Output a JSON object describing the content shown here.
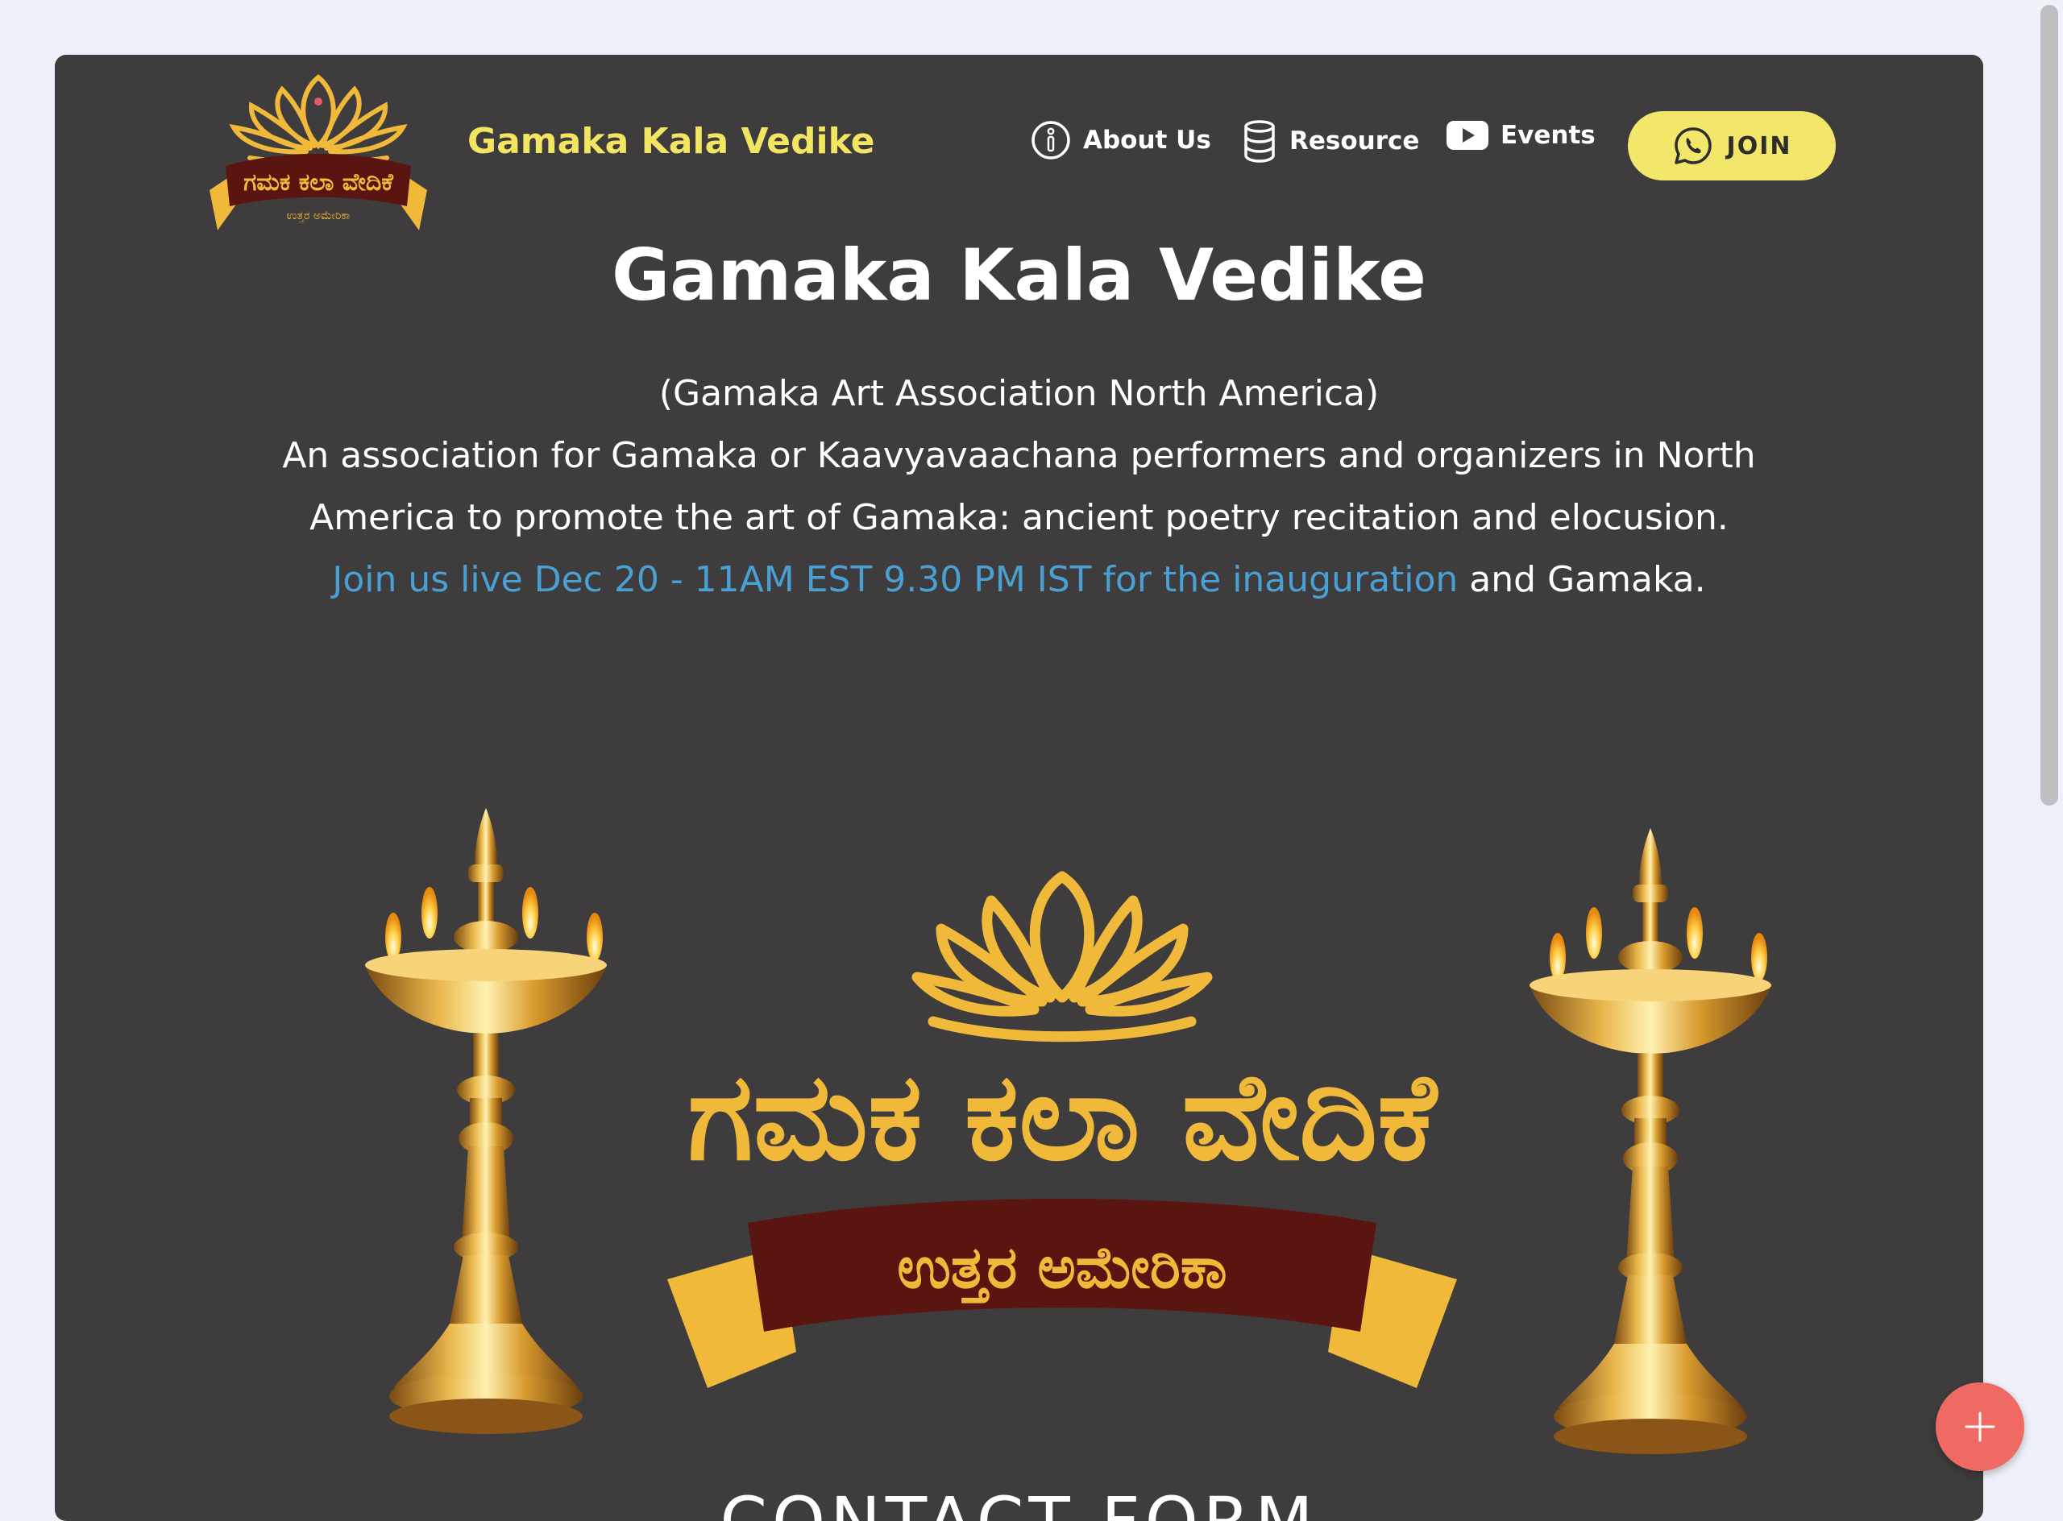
{
  "header": {
    "logo_alt": "ಗಮಕ ಕಲಾ ವೇದಿಕೆ ಉತ್ತರ ಅಮೇರಿಕಾ",
    "brand": "Gamaka Kala Vedike",
    "nav": [
      {
        "label": "About Us",
        "icon": "info-icon"
      },
      {
        "label": "Resource",
        "icon": "database-icon"
      },
      {
        "label": "Events",
        "icon": "youtube-icon"
      }
    ],
    "join": {
      "label": "JOIN",
      "icon": "whatsapp-icon"
    }
  },
  "hero": {
    "title": "Gamaka Kala Vedike",
    "subtitle": "(Gamaka Art Association North America)",
    "line1": "An association for Gamaka or Kaavyavaachana performers and organizers in North",
    "line2": "America to promote the art of Gamaka: ancient poetry recitation and elocusion.",
    "link_text": "Join us live Dec 20 - 11AM EST 9.30 PM IST for the inauguration",
    "link_suffix": " and Gamaka."
  },
  "banner": {
    "title_kn": "ಗಮಕ ಕಲಾ ವೇದಿಕೆ",
    "ribbon_kn": "ಉತ್ತರ ಅಮೇರಿಕಾ"
  },
  "contact": {
    "heading": "CONTACT FORM"
  },
  "fab": {
    "icon": "plus-icon"
  },
  "colors": {
    "page_bg": "#eef1f9",
    "card_bg": "#3e3c3c",
    "brand_yellow": "#f2e561",
    "gold": "#f0b93a",
    "ribbon_maroon": "#5a1510",
    "link_blue": "#4aa0d3",
    "fab_red": "#ee6a62"
  }
}
